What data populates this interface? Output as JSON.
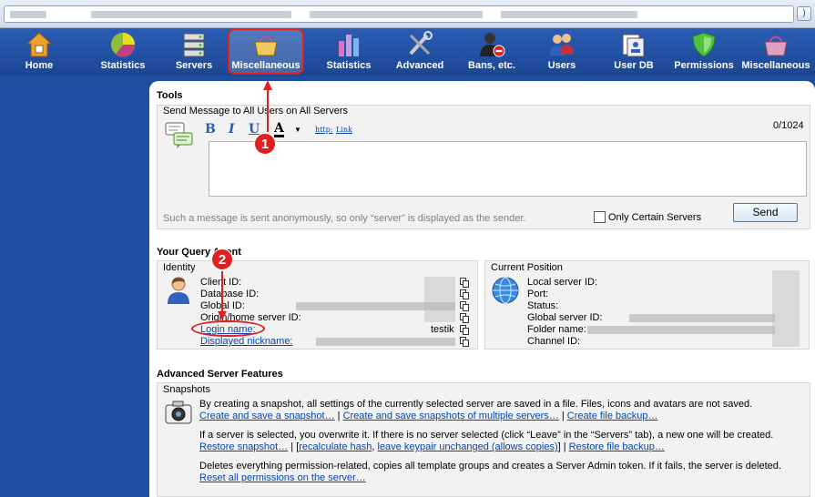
{
  "toolbar": {
    "items": [
      {
        "label": "Home",
        "icon": "house-icon"
      },
      {
        "label": "Statistics",
        "icon": "pie-chart-icon"
      },
      {
        "label": "Servers",
        "icon": "server-rack-icon"
      },
      {
        "label": "Miscellaneous",
        "icon": "basket-icon"
      },
      {
        "label": "Statistics",
        "icon": "bar-chart-icon"
      },
      {
        "label": "Advanced",
        "icon": "tools-icon"
      },
      {
        "label": "Bans, etc.",
        "icon": "banned-user-icon"
      },
      {
        "label": "Users",
        "icon": "users-icon"
      },
      {
        "label": "User DB",
        "icon": "user-db-icon"
      },
      {
        "label": "Permissions",
        "icon": "shield-icon"
      },
      {
        "label": "Miscellaneous",
        "icon": "basket-icon"
      }
    ]
  },
  "tools": {
    "title": "Tools",
    "send_message": {
      "group_title": "Send Message to All Users on All Servers",
      "counter": "0/1024",
      "fmt_bold": "B",
      "fmt_italic": "I",
      "fmt_underline": "U",
      "fmt_color": "A",
      "link_http": "http:",
      "link_link": "Link",
      "hint": "Such a message is sent anonymously, so only “server” is displayed as the sender.",
      "only_certain_servers": "Only Certain Servers",
      "send_label": "Send"
    }
  },
  "query_agent": {
    "title": "Your Query Agent",
    "identity": {
      "title": "Identity",
      "client_id": "Client ID:",
      "database_id": "Database ID:",
      "global_id": "Global ID:",
      "origin_server_id": "Origin/home server ID:",
      "login_name": "Login name:",
      "login_value": "testik",
      "displayed_nickname": "Displayed nickname:"
    },
    "position": {
      "title": "Current Position",
      "local_server_id": "Local server ID:",
      "port": "Port:",
      "status": "Status:",
      "global_server_id": "Global server ID:",
      "folder_name": "Folder name:",
      "channel_id": "Channel ID:"
    }
  },
  "advanced": {
    "title": "Advanced Server Features",
    "snapshots": {
      "title": "Snapshots",
      "desc1": "By creating a snapshot, all settings of the currently selected server are saved in a file. Files, icons and avatars are not saved.",
      "link_create": "Create and save a snapshot…",
      "link_create_multi": "Create and save snapshots of multiple servers…",
      "link_create_backup": "Create file backup…",
      "sep": "|",
      "desc2": "If a server is selected, you overwrite it. If there is no server selected (click “Leave” in the “Servers” tab), a new one will be created.",
      "link_restore": "Restore snapshot…",
      "bracket_open": "[",
      "link_recalc": "recalculate hash",
      "comma": ",",
      "link_keypair": "leave keypair unchanged (allows copies)",
      "bracket_close": "]",
      "link_restore_backup": "Restore file backup…",
      "desc3": "Deletes everything permission-related, copies all template groups and creates a Server Admin token. If it fails, the server is deleted.",
      "link_reset": "Reset all permissions on the server…"
    }
  },
  "annotations": {
    "one": "1",
    "two": "2"
  },
  "colors": {
    "toolbar": "#1f4fa0",
    "link": "#0645ad",
    "annotation": "#e02020"
  }
}
